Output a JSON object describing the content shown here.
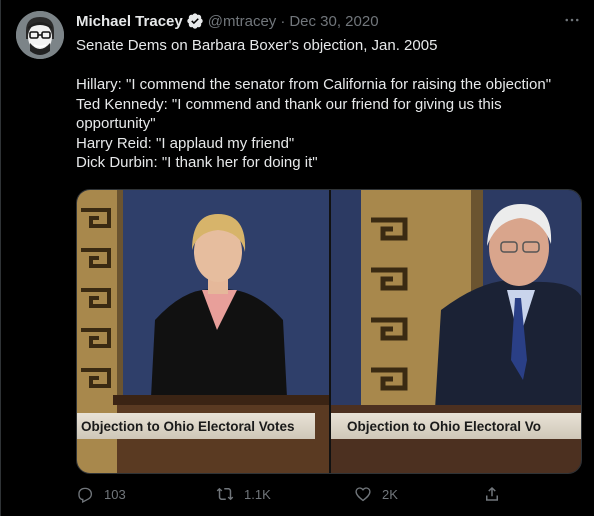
{
  "tweet": {
    "author_name": "Michael Tracey",
    "handle": "@mtracey",
    "separator": "·",
    "date": "Dec 30, 2020",
    "text_lines": [
      "Senate Dems on Barbara Boxer's objection, Jan. 2005",
      "",
      "Hillary: \"I commend the senator from California for raising the objection\"",
      "Ted Kennedy: \"I commend and thank our friend for giving us this",
      "opportunity\"",
      "Harry Reid: \"I applaud my friend\"",
      "Dick Durbin: \"I thank her for doing it\""
    ]
  },
  "media": {
    "left_caption": "Objection to Ohio Electoral Votes",
    "right_caption": "Objection to Ohio Electoral Vo"
  },
  "actions": {
    "reply_count": "103",
    "retweet_count": "1.1K",
    "like_count": "2K"
  },
  "colors": {
    "background": "#000000",
    "text_primary": "#e7e9ea",
    "text_secondary": "#71767b",
    "verified_badge": "#e7e9ea"
  },
  "icons": [
    "avatar",
    "verified-badge-icon",
    "more-icon",
    "reply-icon",
    "retweet-icon",
    "like-icon",
    "share-icon"
  ]
}
